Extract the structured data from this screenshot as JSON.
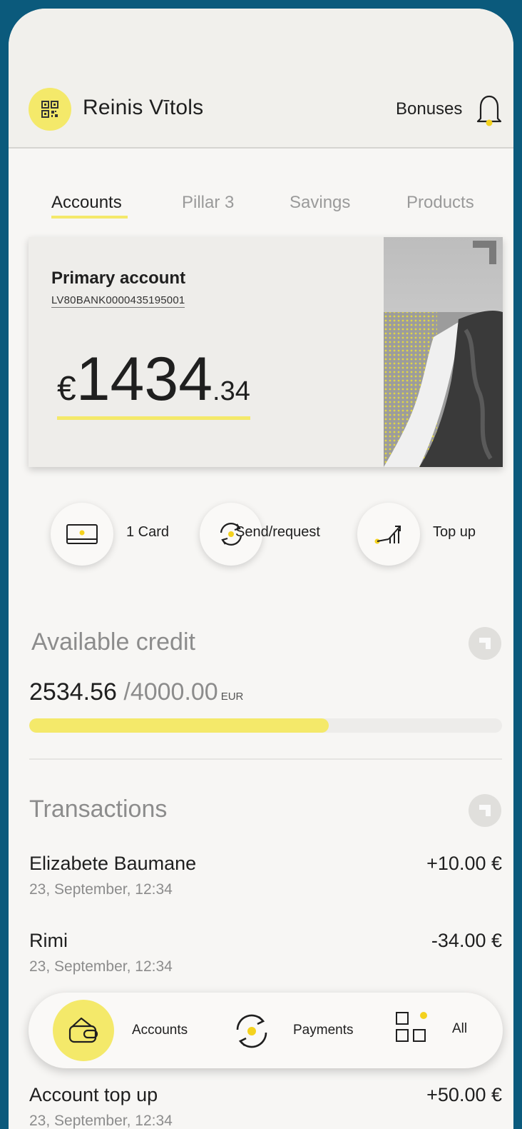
{
  "header": {
    "user_name": "Reinis Vītols",
    "bonuses_label": "Bonuses"
  },
  "tabs": [
    {
      "label": "Accounts",
      "active": true
    },
    {
      "label": "Pillar 3",
      "active": false
    },
    {
      "label": "Savings",
      "active": false
    },
    {
      "label": "Products",
      "active": false
    }
  ],
  "account": {
    "title": "Primary account",
    "iban": "LV80BANK0000435195001",
    "currency_symbol": "€",
    "balance_main": "1434",
    "balance_cents": ".34"
  },
  "actions": [
    {
      "label": "1 Card",
      "icon": "card-icon"
    },
    {
      "label": "Send/request",
      "icon": "send-request-icon"
    },
    {
      "label": "Top up",
      "icon": "top-up-icon"
    }
  ],
  "credit": {
    "title": "Available credit",
    "used": "2534.56",
    "separator": " /",
    "limit": "4000.00",
    "currency": "EUR",
    "progress_fraction": 0.6336
  },
  "transactions": {
    "title": "Transactions",
    "items": [
      {
        "name": "Elizabete Baumane",
        "date": "23, September, 12:34",
        "amount": "+10.00 €"
      },
      {
        "name": "Rimi",
        "date": "23, September, 12:34",
        "amount": "-34.00 €"
      },
      {
        "name": "Account top up",
        "date": "23, September, 12:34",
        "amount": "+50.00 €"
      }
    ]
  },
  "bottom_nav": [
    {
      "label": "Accounts",
      "icon": "wallet-icon",
      "active": true
    },
    {
      "label": "Payments",
      "icon": "payments-icon",
      "active": false
    },
    {
      "label": "All",
      "icon": "grid-icon",
      "active": false
    }
  ],
  "colors": {
    "accent": "#f4e96a",
    "background_frame": "#0b5a7c",
    "surface": "#f7f6f4"
  }
}
